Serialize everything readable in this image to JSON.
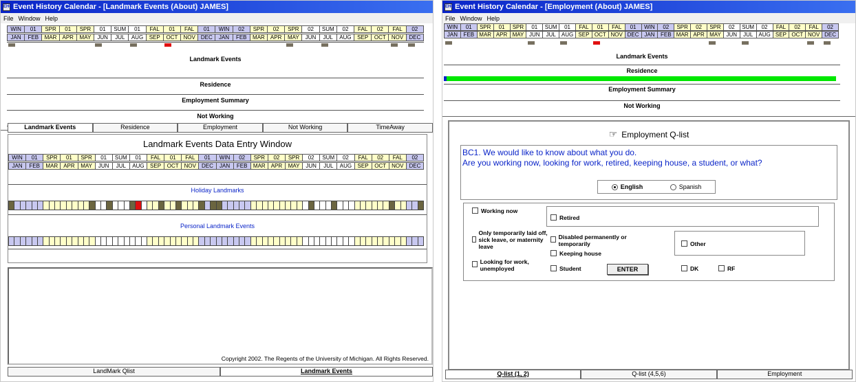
{
  "colors": {
    "winter": "#c8c8f0",
    "spring": "#ffffc8",
    "summer": "#ffffff",
    "fall": "#ffffc8",
    "residence_bar": "#00e800",
    "red_mark": "#e01010"
  },
  "seasons": [
    "WIN",
    "01",
    "SPR",
    "01",
    "SPR",
    "01",
    "SUM",
    "01",
    "FAL",
    "01",
    "FAL",
    "01",
    "WIN",
    "02",
    "SPR",
    "02",
    "SPR",
    "02",
    "SUM",
    "02",
    "FAL",
    "02",
    "FAL",
    "02"
  ],
  "months": [
    "JAN",
    "FEB",
    "MAR",
    "APR",
    "MAY",
    "JUN",
    "JUL",
    "AUG",
    "SEP",
    "OCT",
    "NOV",
    "DEC",
    "JAN",
    "FEB",
    "MAR",
    "APR",
    "MAY",
    "JUN",
    "JUL",
    "AUG",
    "SEP",
    "OCT",
    "NOV",
    "DEC"
  ],
  "w1": {
    "title": "Event History Calendar - [Landmark Events (About) JAMES]",
    "menu": [
      "File",
      "Window",
      "Help"
    ],
    "bands": [
      "Landmark Events",
      "Residence",
      "Employment Summary",
      "Not Working"
    ],
    "tabs": [
      "Landmark Events",
      "Residence",
      "Employment",
      "Not Working",
      "TimeAway"
    ],
    "entry_title": "Landmark Events Data Entry Window",
    "holiday": "Holiday Landmarks",
    "personal": "Personal Landmark Events",
    "copyright": "Copyright 2002.  The Regents of the University of Michigan.  All Rights Reserved.",
    "bottom_tabs": [
      "LandMark Qlist",
      "Landmark Events"
    ]
  },
  "w2": {
    "title": "Event History Calendar - [Employment (About) JAMES]",
    "menu": [
      "File",
      "Window",
      "Help"
    ],
    "bands": [
      "Landmark Events",
      "Residence",
      "Employment Summary",
      "Not Working"
    ],
    "qlist_title": "Employment Q-list",
    "question_line1": "BC1. We would like to know about what you do.",
    "question_line2": "Are you working now,  looking for work,  retired,  keeping house,  a student,  or what?",
    "lang": [
      "English",
      "Spanish"
    ],
    "opts": {
      "working_now": "Working now",
      "temp": "Only temporarily laid off, sick leave, or maternity leave",
      "looking": "Looking for work, unemployed",
      "retired": "Retired",
      "disabled": "Disabled  permanently or temporarily",
      "keeping": "Keeping house",
      "student": "Student",
      "other": "Other",
      "dk": "DK",
      "rf": "RF"
    },
    "enter": "ENTER",
    "bottom_tabs": [
      "Q-list (1, 2)",
      "Q-list (4,5,6)",
      "Employment"
    ]
  }
}
